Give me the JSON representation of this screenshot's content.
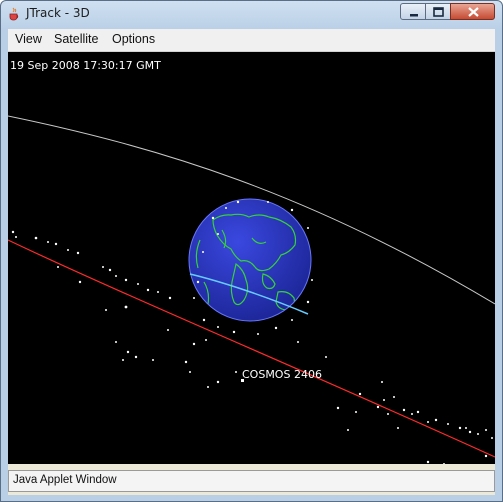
{
  "window": {
    "title": "JTrack - 3D",
    "icon": "java-cup-icon",
    "controls": [
      "minimize-icon",
      "maximize-icon",
      "close-icon"
    ]
  },
  "menubar": {
    "items": [
      "View",
      "Satellite",
      "Options"
    ]
  },
  "view": {
    "timestamp": "19 Sep 2008 17:30:17 GMT",
    "selected_satellite": "COSMOS 2406",
    "colors": {
      "background": "#000000",
      "ocean": "#2a36c8",
      "coastline": "#34d23a",
      "selected_orbit": "#ff2a2a",
      "other_orbit": "#c8c8c8",
      "ground_track": "#66ccff",
      "satellite": "#ffffff"
    }
  },
  "status": {
    "text": "Java Applet Window"
  }
}
